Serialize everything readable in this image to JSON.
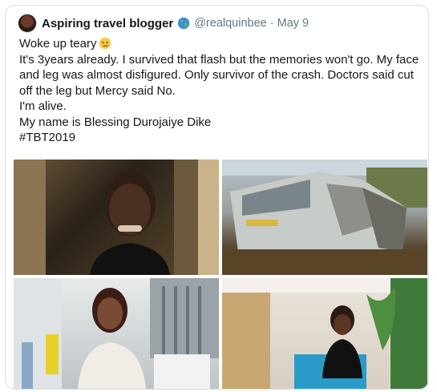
{
  "tweet": {
    "display_name": "Aspiring travel blogger",
    "handle": "@realquinbee",
    "separator": "·",
    "date": "May 9",
    "globe_icon": "globe-emoji-icon",
    "lines": [
      "Woke up teary",
      "It's 3years already. I survived that flash but the memories won't go. My face and leg was almost disfigured. Only survivor of the crash. Doctors said cut off the leg but  Mercy said No.",
      "I'm alive.",
      "My name is Blessing Durojaiye Dike",
      "#TBT2019"
    ],
    "teary_emoji_icon": "crying-face-icon",
    "photos": [
      {
        "name": "photo-smiling-woman-hospital"
      },
      {
        "name": "photo-crashed-bus"
      },
      {
        "name": "photo-woman-in-lace-top"
      },
      {
        "name": "photo-woman-seated-office"
      }
    ]
  },
  "colors": {
    "border": "#d7dee3",
    "secondary_text": "#657786",
    "primary_text": "#14171a"
  }
}
